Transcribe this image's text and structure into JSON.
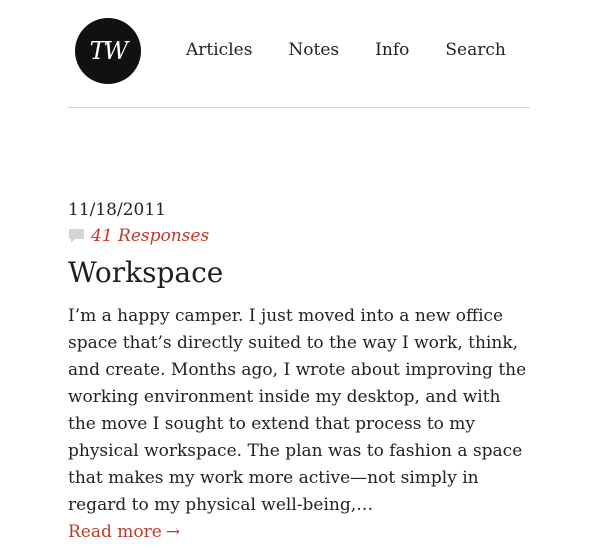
{
  "site": {
    "logo_text": "TW"
  },
  "nav": [
    {
      "label": "Articles"
    },
    {
      "label": "Notes"
    },
    {
      "label": "Info"
    },
    {
      "label": "Search"
    }
  ],
  "post": {
    "date": "11/18/2011",
    "responses": "41 Responses",
    "title": "Workspace",
    "excerpt": "I’m a happy camper. I just moved into a new office space that’s directly suited to the way I work, think, and create. Months ago, I wrote about improving the working environment inside my desktop, and with the move I sought to extend that process to my physical workspace. The plan was to fashion a space that makes my work more active—not simply in regard to my physical well-being,…",
    "read_more": "Read more",
    "read_more_arrow": "→"
  },
  "colors": {
    "accent": "#c0392b",
    "logo_bg": "#111111",
    "divider": "#d6d6d6"
  }
}
